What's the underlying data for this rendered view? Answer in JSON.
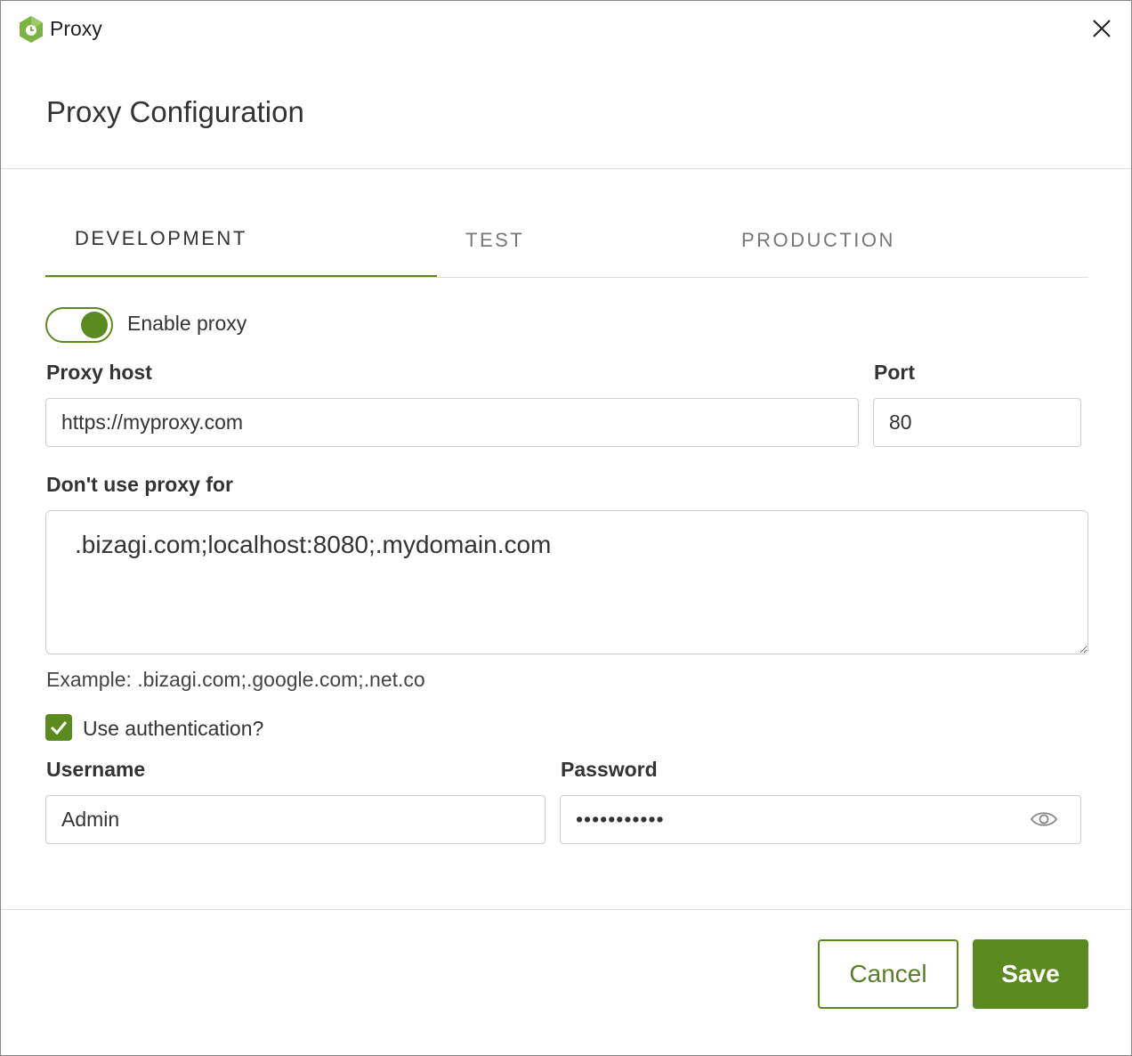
{
  "window": {
    "title": "Proxy",
    "close_icon": "close-icon",
    "logo_icon": "bizagi-logo-icon"
  },
  "dialog": {
    "title": "Proxy Configuration"
  },
  "tabs": [
    {
      "label": "DEVELOPMENT",
      "active": true
    },
    {
      "label": "TEST",
      "active": false
    },
    {
      "label": "PRODUCTION",
      "active": false
    }
  ],
  "form": {
    "enable_proxy": {
      "label": "Enable proxy",
      "on": true
    },
    "proxy_host": {
      "label": "Proxy host",
      "value": "https://myproxy.com"
    },
    "port": {
      "label": "Port",
      "value": "80"
    },
    "exclusions": {
      "label": "Don't use proxy for",
      "value": ".bizagi.com;localhost:8080;.mydomain.com",
      "example": "Example: .bizagi.com;.google.com;.net.co"
    },
    "use_auth": {
      "label": "Use authentication?",
      "checked": true
    },
    "username": {
      "label": "Username",
      "value": "Admin"
    },
    "password": {
      "label": "Password",
      "value": "•••••••••••",
      "reveal_icon": "eye-icon"
    }
  },
  "buttons": {
    "cancel": "Cancel",
    "save": "Save"
  },
  "colors": {
    "accent": "#5b8a1e",
    "border": "#cfcfcf",
    "divider": "#dcdcdc"
  }
}
